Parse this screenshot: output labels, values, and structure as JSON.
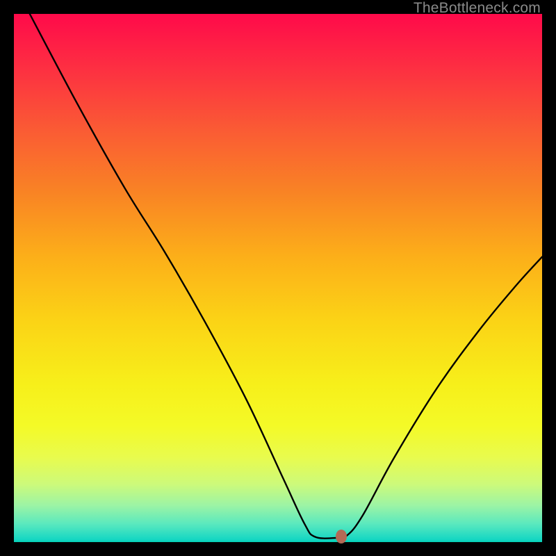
{
  "watermark": "TheBottleneck.com",
  "chart_data": {
    "type": "line",
    "title": "",
    "xlabel": "",
    "ylabel": "",
    "xlim": [
      0,
      100
    ],
    "ylim": [
      0,
      100
    ],
    "gradient_colors": {
      "top": "#ff0a4a",
      "mid_upper": "#f98424",
      "mid": "#fbd316",
      "mid_lower": "#f4fa27",
      "bottom": "#04cfb4"
    },
    "curve_points": [
      {
        "x": 3.0,
        "y": 100.0
      },
      {
        "x": 12.0,
        "y": 83.0
      },
      {
        "x": 21.0,
        "y": 67.0
      },
      {
        "x": 28.5,
        "y": 55.0
      },
      {
        "x": 36.0,
        "y": 42.0
      },
      {
        "x": 44.0,
        "y": 27.0
      },
      {
        "x": 51.0,
        "y": 12.0
      },
      {
        "x": 55.0,
        "y": 3.5
      },
      {
        "x": 57.0,
        "y": 1.0
      },
      {
        "x": 61.0,
        "y": 0.8
      },
      {
        "x": 63.0,
        "y": 1.2
      },
      {
        "x": 66.0,
        "y": 5.0
      },
      {
        "x": 72.0,
        "y": 16.0
      },
      {
        "x": 80.0,
        "y": 29.0
      },
      {
        "x": 88.0,
        "y": 40.0
      },
      {
        "x": 95.0,
        "y": 48.5
      },
      {
        "x": 100.0,
        "y": 54.0
      }
    ],
    "marker": {
      "x": 62.0,
      "y": 1.0,
      "color": "#b36a56"
    }
  }
}
